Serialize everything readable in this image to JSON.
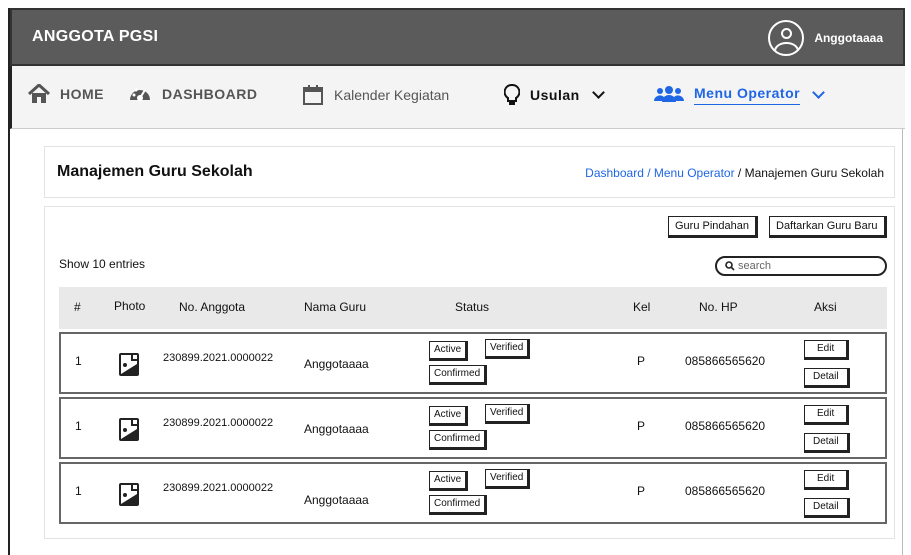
{
  "app": {
    "brand": "ANGGOTA PGSI",
    "username": "Anggotaaaa"
  },
  "nav": {
    "home": "HOME",
    "dashboard": "DASHBOARD",
    "kalender": "Kalender Kegiatan",
    "usulan": "Usulan",
    "menu_operator": "Menu Operator"
  },
  "page": {
    "title": "Manajemen Guru Sekolah",
    "breadcrumb": {
      "link": "Dashboard / Menu Operator",
      "current": " / Manajemen Guru Sekolah"
    }
  },
  "toolbar": {
    "pindahan": "Guru Pindahan",
    "daftar": "Daftarkan Guru Baru"
  },
  "table": {
    "show_entries": "Show 10 entries",
    "search_placeholder": "search",
    "headers": [
      "#",
      "Photo",
      "No. Anggota",
      "Nama Guru",
      "Status",
      "Kel",
      "No. HP",
      "Aksi"
    ],
    "rows": [
      {
        "no": "1",
        "anggota": "230899.2021.0000022",
        "nama": "Anggotaaaa",
        "status": [
          "Active",
          "Verified",
          "Confirmed"
        ],
        "kel": "P",
        "hp": "085866565620",
        "edit": "Edit",
        "detail": "Detail"
      },
      {
        "no": "1",
        "anggota": "230899.2021.0000022",
        "nama": "Anggotaaaa",
        "status": [
          "Active",
          "Verified",
          "Confirmed"
        ],
        "kel": "P",
        "hp": "085866565620",
        "edit": "Edit",
        "detail": "Detail"
      },
      {
        "no": "1",
        "anggota": "230899.2021.0000022",
        "nama": "Anggotaaaa",
        "status": [
          "Active",
          "Verified",
          "Confirmed"
        ],
        "kel": "P",
        "hp": "085866565620",
        "edit": "Edit",
        "detail": "Detail"
      }
    ]
  },
  "icons": [
    "home-icon",
    "dashboard-icon",
    "calendar-icon",
    "lightbulb-icon",
    "users-icon",
    "chevron-down-icon",
    "search-icon",
    "image-icon",
    "user-avatar-icon"
  ],
  "colors": {
    "topbar": "#5b5b5b",
    "accent": "#1f66e5",
    "header_bg": "#e9e9e9"
  }
}
